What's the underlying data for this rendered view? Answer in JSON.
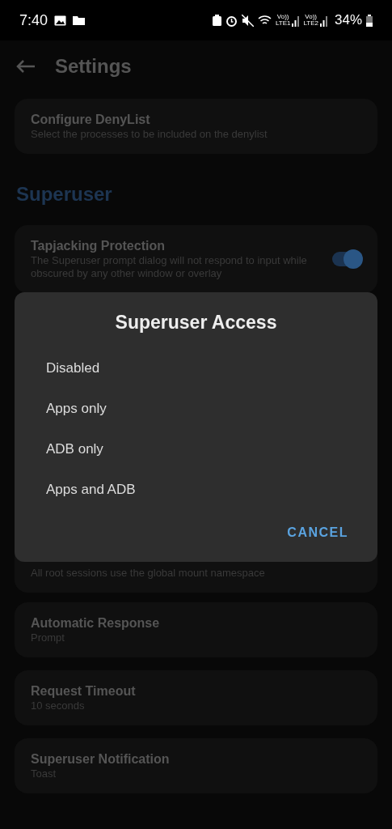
{
  "status_bar": {
    "time": "7:40",
    "networks": [
      {
        "top": "Vo))",
        "bottom": "LTE1"
      },
      {
        "top": "Vo))",
        "bottom": "LTE2"
      }
    ],
    "battery": "34%"
  },
  "toolbar": {
    "title": "Settings"
  },
  "items_top": [
    {
      "title": "Configure DenyList",
      "subtitle": "Select the processes to be included on the denylist"
    }
  ],
  "section": {
    "title": "Superuser"
  },
  "toggle_item": {
    "title": "Tapjacking Protection",
    "subtitle": "The Superuser prompt dialog will not respond to input while obscured by any other window or overlay",
    "on": true
  },
  "partial_item": {
    "subtitle": "All root sessions use the global mount namespace"
  },
  "items": [
    {
      "title": "Automatic Response",
      "subtitle": "Prompt"
    },
    {
      "title": "Request Timeout",
      "subtitle": "10 seconds"
    },
    {
      "title": "Superuser Notification",
      "subtitle": "Toast"
    }
  ],
  "dialog": {
    "title": "Superuser Access",
    "options": [
      "Disabled",
      "Apps only",
      "ADB only",
      "Apps and ADB"
    ],
    "button": "CANCEL"
  }
}
